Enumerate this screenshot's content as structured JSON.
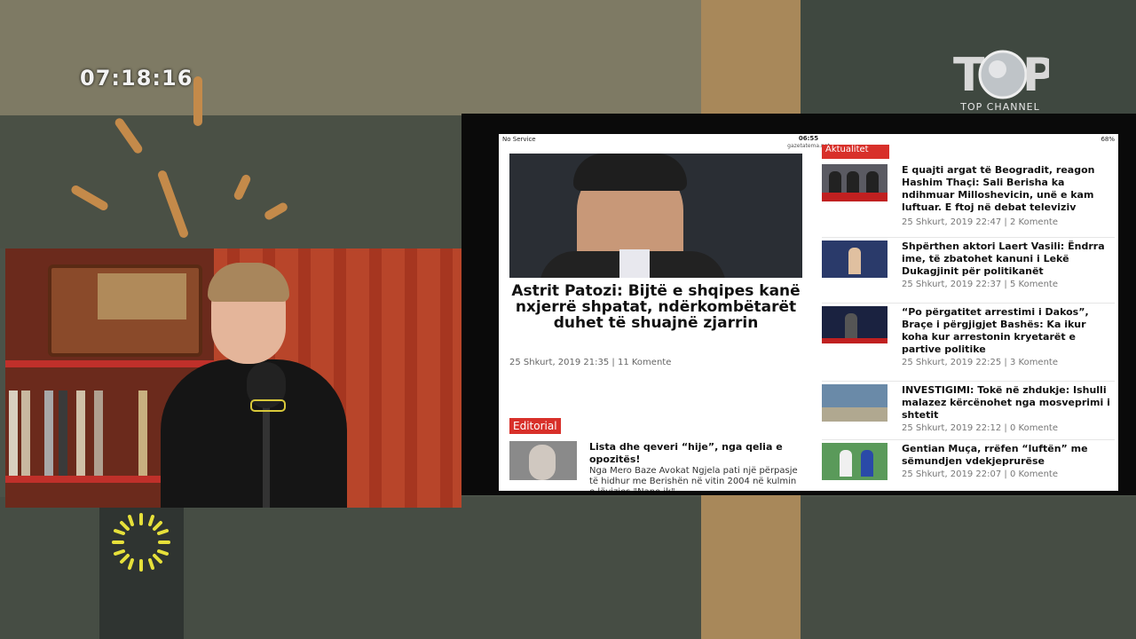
{
  "overlay": {
    "clock": "07:18:16",
    "channel_logo_text": "TOP CHANNEL"
  },
  "browser": {
    "status_left": "No Service",
    "status_time": "06:55",
    "status_url": "gazetatema.net",
    "status_battery": "68%"
  },
  "article": {
    "section_tag": "Aktualitet",
    "headline": "Astrit Patozi: Bijtë e shqipes kanë nxjerrë shpatat, ndërkombëtarët duhet të shuajnë zjarrin",
    "meta": "25 Shkurt, 2019 21:35 | 11 Komente"
  },
  "editorial": {
    "tag": "Editorial",
    "title": "Lista dhe qeveri “hije”, nga qelia e opozitës!",
    "excerpt": "Nga Mero Baze Avokat Ngjela pati një përpasje të hidhur me Berishën në vitin 2004 në kulmin e lëvizjes \"Nano ik\""
  },
  "news": [
    {
      "title": "E quajti argat të Beogradit, reagon Hashim Thaçi: Sali Berisha ka ndihmuar Milloshevicin, unë e kam luftuar. E ftoj në debat televiziv",
      "meta": "25 Shkurt, 2019 22:47 | 2 Komente"
    },
    {
      "title": "Shpërthen aktori Laert Vasili: Ëndrra ime, të zbatohet kanuni i Lekë Dukagjinit për politikanët",
      "meta": "25 Shkurt, 2019 22:37 | 5 Komente"
    },
    {
      "title": "“Po përgatitet arrestimi i Dakos”, Braçe i përgjigjet Bashës: Ka ikur koha kur arrestonin kryetarët e partive politike",
      "meta": "25 Shkurt, 2019 22:25 | 3 Komente"
    },
    {
      "title": "INVESTIGIMI: Tokë në zhdukje: Ishulli malazez kërcënohet nga mosveprimi i shtetit",
      "meta": "25 Shkurt, 2019 22:12 | 0 Komente"
    },
    {
      "title": "Gentian Muça, rrëfen “luftën” me sëmundjen vdekjeprurëse",
      "meta": "25 Shkurt, 2019 22:07 | 0 Komente"
    }
  ]
}
